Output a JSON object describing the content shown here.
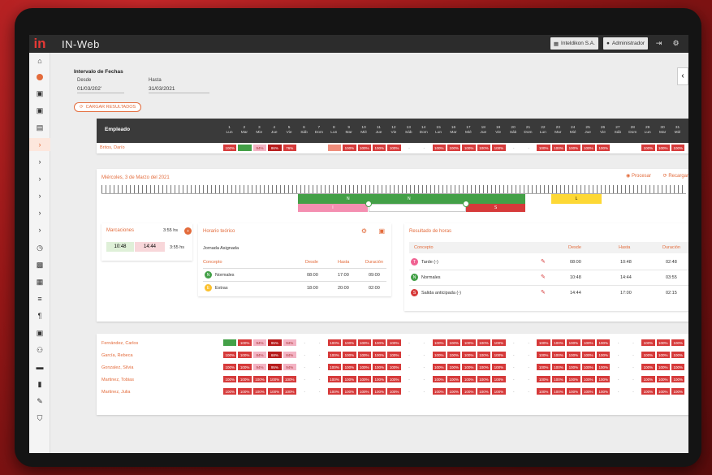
{
  "app": {
    "title": "IN-Web",
    "logo": "in",
    "company": "Inteldikon S.A.",
    "user": "Administrador"
  },
  "filters": {
    "heading": "Intervalo de Fechas",
    "from_label": "Desde",
    "from_value": "01/03/202'",
    "to_label": "Hasta",
    "to_value": "31/03/2021",
    "load_button": "CARGAR RESULTADOS"
  },
  "grid": {
    "employee_header": "Empleado",
    "days": [
      {
        "n": "1",
        "d": "Lun"
      },
      {
        "n": "2",
        "d": "Mar"
      },
      {
        "n": "3",
        "d": "Mie"
      },
      {
        "n": "4",
        "d": "Jue"
      },
      {
        "n": "5",
        "d": "Vie"
      },
      {
        "n": "6",
        "d": "Sáb"
      },
      {
        "n": "7",
        "d": "Dom"
      },
      {
        "n": "8",
        "d": "Lun"
      },
      {
        "n": "9",
        "d": "Mar"
      },
      {
        "n": "10",
        "d": "Mié"
      },
      {
        "n": "11",
        "d": "Jue"
      },
      {
        "n": "12",
        "d": "Vie"
      },
      {
        "n": "13",
        "d": "Sáb"
      },
      {
        "n": "14",
        "d": "Dom"
      },
      {
        "n": "15",
        "d": "Lun"
      },
      {
        "n": "16",
        "d": "Mar"
      },
      {
        "n": "17",
        "d": "Mié"
      },
      {
        "n": "18",
        "d": "Jue"
      },
      {
        "n": "19",
        "d": "Vie"
      },
      {
        "n": "20",
        "d": "Sáb"
      },
      {
        "n": "21",
        "d": "Dom"
      },
      {
        "n": "22",
        "d": "Lun"
      },
      {
        "n": "23",
        "d": "Mar"
      },
      {
        "n": "24",
        "d": "Mié"
      },
      {
        "n": "25",
        "d": "Jue"
      },
      {
        "n": "26",
        "d": "Vie"
      },
      {
        "n": "27",
        "d": "Sáb"
      },
      {
        "n": "28",
        "d": "Dom"
      },
      {
        "n": "29",
        "d": "Lun"
      },
      {
        "n": "30",
        "d": "Mar"
      },
      {
        "n": "31",
        "d": "Mié"
      }
    ],
    "first_employee": "Britos, Darío",
    "first_row": [
      "100%",
      "",
      "94%",
      "86%",
      "76%",
      "",
      "",
      "",
      "100%",
      "100%",
      "100%",
      "100%",
      "-",
      "-",
      "100%",
      "100%",
      "100%",
      "100%",
      "100%",
      "-",
      "-",
      "100%",
      "100%",
      "100%",
      "100%",
      "100%",
      "",
      "",
      "100%",
      "100%",
      "100%"
    ]
  },
  "detail": {
    "date_title": "Miércoles, 3 de Marzo del 2021",
    "process_btn": "Procesar",
    "recalc_btn": "Recargar",
    "timeline": {
      "n1": "N",
      "n2": "N",
      "l": "L",
      "i": "I",
      "s": "S"
    },
    "marks": {
      "title": "Marcaciones",
      "total": "3:55 hs",
      "in": "10:48",
      "out": "14:44",
      "diff": "3:55 hs"
    },
    "schedule": {
      "title": "Horario teórico",
      "subtitle": "Jornada Asignada",
      "cols": [
        "Concepto",
        "Desde",
        "Hasta",
        "Duración"
      ],
      "rows": [
        {
          "badge": "N",
          "name": "Normales",
          "from": "08:00",
          "to": "17:00",
          "dur": "09:00"
        },
        {
          "badge": "E",
          "name": "Extras",
          "from": "18:00",
          "to": "20:00",
          "dur": "02:00"
        }
      ]
    },
    "results": {
      "title": "Resultado de horas",
      "cols": [
        "Concepto",
        "Desde",
        "Hasta",
        "Duración"
      ],
      "rows": [
        {
          "badge": "T",
          "name": "Tarde (-)",
          "from": "08:00",
          "to": "10:48",
          "dur": "02:48"
        },
        {
          "badge": "N",
          "name": "Normales",
          "from": "10:48",
          "to": "14:44",
          "dur": "03:55"
        },
        {
          "badge": "S",
          "name": "Salida anticipada (-)",
          "from": "14:44",
          "to": "17:00",
          "dur": "02:15"
        }
      ]
    }
  },
  "employees": [
    {
      "name": "Fernández, Carlos",
      "cells": [
        "",
        "100%",
        "94%",
        "95%",
        "94%",
        "-",
        "-",
        "100%",
        "100%",
        "100%",
        "100%",
        "100%",
        "-",
        "-",
        "100%",
        "100%",
        "100%",
        "100%",
        "100%",
        "-",
        "-",
        "100%",
        "100%",
        "100%",
        "100%",
        "100%",
        "-",
        "-",
        "100%",
        "100%",
        "100%"
      ]
    },
    {
      "name": "García, Rebeca",
      "cells": [
        "100%",
        "100%",
        "84%",
        "68%",
        "84%",
        "-",
        "-",
        "100%",
        "100%",
        "100%",
        "100%",
        "100%",
        "-",
        "-",
        "100%",
        "100%",
        "100%",
        "100%",
        "100%",
        "-",
        "-",
        "100%",
        "100%",
        "100%",
        "100%",
        "100%",
        "-",
        "-",
        "100%",
        "100%",
        "100%"
      ]
    },
    {
      "name": "Gonzalez, Silvia",
      "cells": [
        "100%",
        "100%",
        "94%",
        "95%",
        "94%",
        "-",
        "-",
        "100%",
        "100%",
        "100%",
        "100%",
        "100%",
        "-",
        "-",
        "100%",
        "100%",
        "100%",
        "100%",
        "100%",
        "-",
        "-",
        "100%",
        "100%",
        "100%",
        "100%",
        "100%",
        "-",
        "-",
        "100%",
        "100%",
        "100%"
      ]
    },
    {
      "name": "Martinez, Tobias",
      "cells": [
        "100%",
        "100%",
        "100%",
        "100%",
        "100%",
        "-",
        "-",
        "100%",
        "100%",
        "100%",
        "100%",
        "100%",
        "-",
        "-",
        "100%",
        "100%",
        "100%",
        "100%",
        "100%",
        "-",
        "-",
        "100%",
        "100%",
        "100%",
        "100%",
        "100%",
        "-",
        "-",
        "100%",
        "100%",
        "100%"
      ]
    },
    {
      "name": "Martinez, Julia",
      "cells": [
        "100%",
        "100%",
        "100%",
        "100%",
        "100%",
        "-",
        "-",
        "100%",
        "100%",
        "100%",
        "100%",
        "100%",
        "-",
        "-",
        "100%",
        "100%",
        "100%",
        "100%",
        "100%",
        "-",
        "-",
        "100%",
        "100%",
        "100%",
        "100%",
        "100%",
        "-",
        "-",
        "100%",
        "100%",
        "100%"
      ]
    }
  ],
  "colors": {
    "accent": "#e36b3b",
    "red": "#d63a3a",
    "green": "#43a047",
    "pink": "#f3b3c4"
  }
}
